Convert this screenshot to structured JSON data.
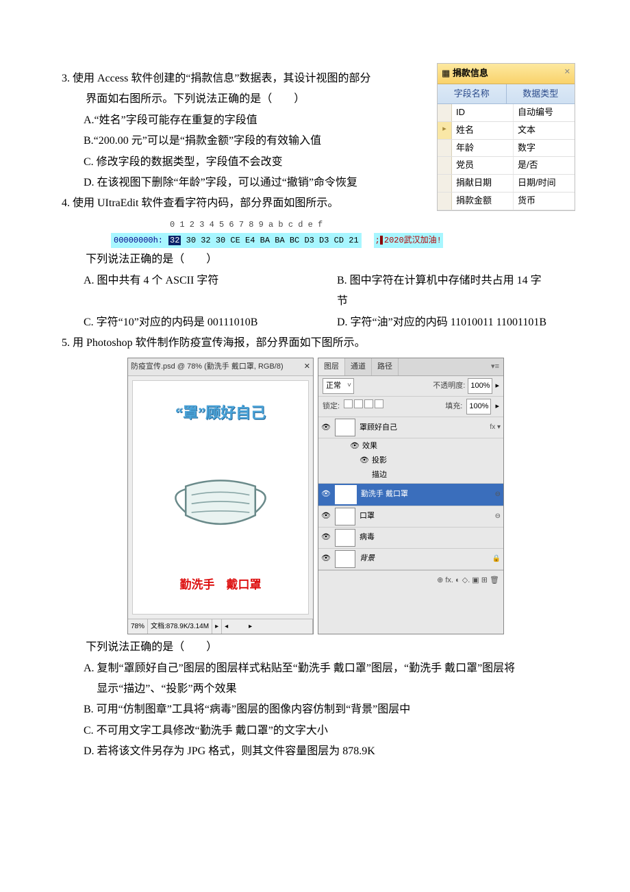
{
  "q3": {
    "prefix": "3.",
    "stem1": "使用 Access 软件创建的“捐款信息”数据表，其设计视图的部分",
    "stem2": "界面如右图所示。下列说法正确的是（　　）",
    "A": "A.“姓名”字段可能存在重复的字段值",
    "B": "B.“200.00 元”可以是“捐款金额”字段的有效输入值",
    "C": "C. 修改字段的数据类型，字段值不会改变",
    "D": "D. 在该视图下删除“年龄”字段，可以通过“撤销”命令恢复",
    "table": {
      "tab": "捐款信息",
      "h1": "字段名称",
      "h2": "数据类型",
      "rows": [
        {
          "sel": "",
          "name": "ID",
          "type": "自动编号"
        },
        {
          "sel": "▸",
          "name": "姓名",
          "type": "文本"
        },
        {
          "sel": "",
          "name": "年龄",
          "type": "数字"
        },
        {
          "sel": "",
          "name": "党员",
          "type": "是/否"
        },
        {
          "sel": "",
          "name": "捐献日期",
          "type": "日期/时间"
        },
        {
          "sel": "",
          "name": "捐款金额",
          "type": "货币"
        }
      ]
    }
  },
  "q4": {
    "prefix": "4.",
    "stem": "使用 UItraEdit 软件查看字符内码，部分界面如图所示。",
    "ue": {
      "ruler": "0  1  2  3  4  5  6  7  8  9  a  b  c  d  e  f",
      "addr": "00000000h:",
      "sel": "32",
      "hex_rest": "30 32 30 CE E4 BA BA BC D3 D3 CD 21",
      "ascii": "2020武汉加油!"
    },
    "lead": "下列说法正确的是（　　）",
    "A": "A. 图中共有 4 个 ASCII 字符",
    "B": "B. 图中字符在计算机中存储时共占用 14 字",
    "B2": "节",
    "C": "C. 字符“10”对应的内码是 00111010B",
    "D": "D. 字符“油”对应的内码 11010011 11001101B"
  },
  "q5": {
    "prefix": "5.",
    "stem": "用 Photoshop 软件制作防疫宣传海报，部分界面如下图所示。",
    "ps": {
      "title": "防疫宣传.psd @ 78% (勤洗手  戴口罩, RGB/8)",
      "canvas_line1": "“罩”顾好自己",
      "canvas_line2": "勤洗手　戴口罩",
      "zoom": "78%",
      "docsize": "文档:878.9K/3.14M",
      "panel_tabs": {
        "layers": "图层",
        "channels": "通道",
        "paths": "路径"
      },
      "mode": "正常",
      "opacity_lbl": "不透明度:",
      "opacity_val": "100%",
      "lock_lbl": "锁定:",
      "fill_lbl": "填充:",
      "fill_val": "100%",
      "fx_label": "效果",
      "fx_shadow": "投影",
      "fx_stroke": "描边",
      "layers": [
        {
          "name": "罩顾好自己",
          "badge": "fx ▾"
        },
        {
          "name": "勤洗手  戴口罩"
        },
        {
          "name": "口罩",
          "badge": "⊖"
        },
        {
          "name": "病毒"
        },
        {
          "name": "背景",
          "badge": "🔒"
        }
      ],
      "footer_icons": "⊕  fx.  ◐  ◇.  ▣  ⊞  🗑"
    },
    "lead": "下列说法正确的是（　　）",
    "A1": "A. 复制“罩顾好自己”图层的图层样式粘贴至“勤洗手 戴口罩”图层，“勤洗手 戴口罩”图层将",
    "A2": "显示“描边”、“投影”两个效果",
    "B": "B. 可用“仿制图章”工具将“病毒”图层的图像内容仿制到“背景”图层中",
    "C": "C. 不可用文字工具修改“勤洗手 戴口罩”的文字大小",
    "D": "D. 若将该文件另存为 JPG 格式，则其文件容量图层为 878.9K"
  }
}
